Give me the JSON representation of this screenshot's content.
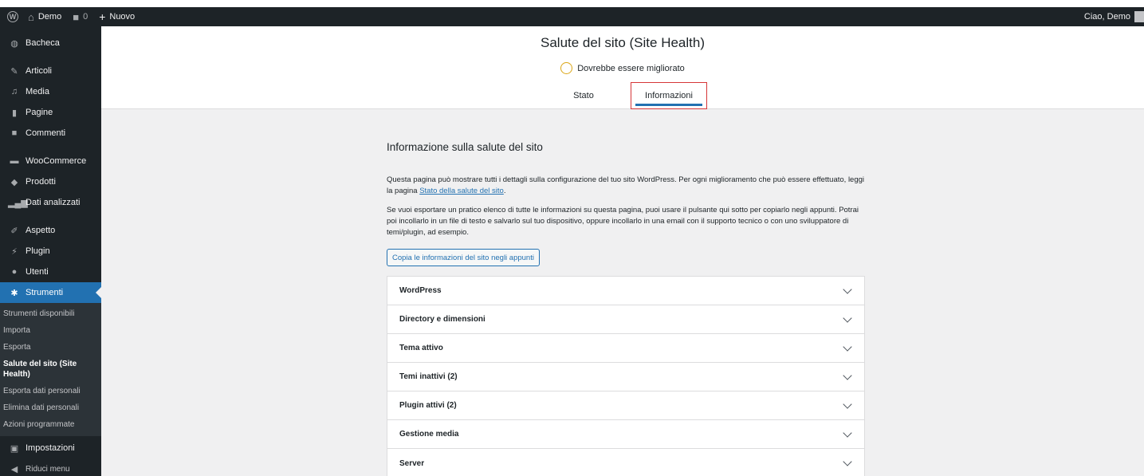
{
  "adminbar": {
    "site_name": "Demo",
    "comments_count": "0",
    "new_label": "Nuovo",
    "greeting": "Ciao, Demo"
  },
  "sidebar": {
    "items": [
      {
        "label": "Bacheca",
        "icon": "dashboard-icon"
      },
      {
        "label": "Articoli",
        "icon": "pin-icon"
      },
      {
        "label": "Media",
        "icon": "media-icon"
      },
      {
        "label": "Pagine",
        "icon": "page-icon"
      },
      {
        "label": "Commenti",
        "icon": "comment-icon"
      },
      {
        "label": "WooCommerce",
        "icon": "woocommerce-icon"
      },
      {
        "label": "Prodotti",
        "icon": "products-icon"
      },
      {
        "label": "Dati analizzati",
        "icon": "analytics-icon"
      },
      {
        "label": "Aspetto",
        "icon": "brush-icon"
      },
      {
        "label": "Plugin",
        "icon": "plugin-icon"
      },
      {
        "label": "Utenti",
        "icon": "users-icon"
      },
      {
        "label": "Strumenti",
        "icon": "wrench-icon"
      },
      {
        "label": "Impostazioni",
        "icon": "settings-icon"
      },
      {
        "label": "Riduci menu",
        "icon": "collapse-icon"
      }
    ],
    "submenu": [
      "Strumenti disponibili",
      "Importa",
      "Esporta",
      "Salute del sito (Site Health)",
      "Esporta dati personali",
      "Elimina dati personali",
      "Azioni programmate"
    ]
  },
  "header": {
    "title": "Salute del sito (Site Health)",
    "status_label": "Dovrebbe essere migliorato",
    "tabs": [
      "Stato",
      "Informazioni"
    ]
  },
  "main": {
    "section_title": "Informazione sulla salute del sito",
    "p1_text": "Questa pagina può mostrare tutti i dettagli sulla configurazione del tuo sito WordPress. Per ogni miglioramento che può essere effettuato, leggi la pagina ",
    "p1_link": "Stato della salute del sito",
    "p2_text": "Se vuoi esportare un pratico elenco di tutte le informazioni su questa pagina, puoi usare il pulsante qui sotto per copiarlo negli appunti. Potrai poi incollarlo in un file di testo e salvarlo sul tuo dispositivo, oppure incollarlo in una email con il supporto tecnico o con uno sviluppatore di temi/plugin, ad esempio.",
    "copy_button": "Copia le informazioni del sito negli appunti",
    "accordion": [
      "WordPress",
      "Directory e dimensioni",
      "Tema attivo",
      "Temi inattivi (2)",
      "Plugin attivi (2)",
      "Gestione media",
      "Server"
    ]
  },
  "colors": {
    "adminbar_bg": "#1d2327",
    "accent": "#2271b1",
    "status_ring": "#dba617",
    "highlight_box": "#d63638"
  }
}
